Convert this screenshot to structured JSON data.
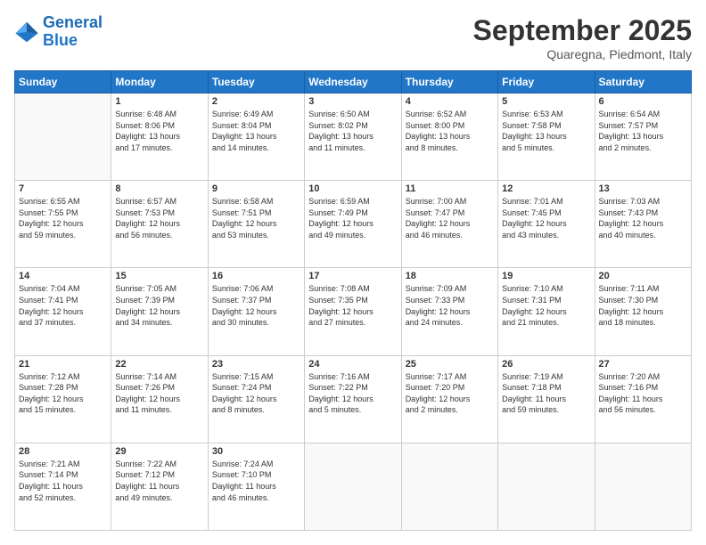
{
  "logo": {
    "line1": "General",
    "line2": "Blue"
  },
  "header": {
    "month": "September 2025",
    "location": "Quaregna, Piedmont, Italy"
  },
  "days_of_week": [
    "Sunday",
    "Monday",
    "Tuesday",
    "Wednesday",
    "Thursday",
    "Friday",
    "Saturday"
  ],
  "weeks": [
    [
      {
        "day": "",
        "info": ""
      },
      {
        "day": "1",
        "info": "Sunrise: 6:48 AM\nSunset: 8:06 PM\nDaylight: 13 hours\nand 17 minutes."
      },
      {
        "day": "2",
        "info": "Sunrise: 6:49 AM\nSunset: 8:04 PM\nDaylight: 13 hours\nand 14 minutes."
      },
      {
        "day": "3",
        "info": "Sunrise: 6:50 AM\nSunset: 8:02 PM\nDaylight: 13 hours\nand 11 minutes."
      },
      {
        "day": "4",
        "info": "Sunrise: 6:52 AM\nSunset: 8:00 PM\nDaylight: 13 hours\nand 8 minutes."
      },
      {
        "day": "5",
        "info": "Sunrise: 6:53 AM\nSunset: 7:58 PM\nDaylight: 13 hours\nand 5 minutes."
      },
      {
        "day": "6",
        "info": "Sunrise: 6:54 AM\nSunset: 7:57 PM\nDaylight: 13 hours\nand 2 minutes."
      }
    ],
    [
      {
        "day": "7",
        "info": "Sunrise: 6:55 AM\nSunset: 7:55 PM\nDaylight: 12 hours\nand 59 minutes."
      },
      {
        "day": "8",
        "info": "Sunrise: 6:57 AM\nSunset: 7:53 PM\nDaylight: 12 hours\nand 56 minutes."
      },
      {
        "day": "9",
        "info": "Sunrise: 6:58 AM\nSunset: 7:51 PM\nDaylight: 12 hours\nand 53 minutes."
      },
      {
        "day": "10",
        "info": "Sunrise: 6:59 AM\nSunset: 7:49 PM\nDaylight: 12 hours\nand 49 minutes."
      },
      {
        "day": "11",
        "info": "Sunrise: 7:00 AM\nSunset: 7:47 PM\nDaylight: 12 hours\nand 46 minutes."
      },
      {
        "day": "12",
        "info": "Sunrise: 7:01 AM\nSunset: 7:45 PM\nDaylight: 12 hours\nand 43 minutes."
      },
      {
        "day": "13",
        "info": "Sunrise: 7:03 AM\nSunset: 7:43 PM\nDaylight: 12 hours\nand 40 minutes."
      }
    ],
    [
      {
        "day": "14",
        "info": "Sunrise: 7:04 AM\nSunset: 7:41 PM\nDaylight: 12 hours\nand 37 minutes."
      },
      {
        "day": "15",
        "info": "Sunrise: 7:05 AM\nSunset: 7:39 PM\nDaylight: 12 hours\nand 34 minutes."
      },
      {
        "day": "16",
        "info": "Sunrise: 7:06 AM\nSunset: 7:37 PM\nDaylight: 12 hours\nand 30 minutes."
      },
      {
        "day": "17",
        "info": "Sunrise: 7:08 AM\nSunset: 7:35 PM\nDaylight: 12 hours\nand 27 minutes."
      },
      {
        "day": "18",
        "info": "Sunrise: 7:09 AM\nSunset: 7:33 PM\nDaylight: 12 hours\nand 24 minutes."
      },
      {
        "day": "19",
        "info": "Sunrise: 7:10 AM\nSunset: 7:31 PM\nDaylight: 12 hours\nand 21 minutes."
      },
      {
        "day": "20",
        "info": "Sunrise: 7:11 AM\nSunset: 7:30 PM\nDaylight: 12 hours\nand 18 minutes."
      }
    ],
    [
      {
        "day": "21",
        "info": "Sunrise: 7:12 AM\nSunset: 7:28 PM\nDaylight: 12 hours\nand 15 minutes."
      },
      {
        "day": "22",
        "info": "Sunrise: 7:14 AM\nSunset: 7:26 PM\nDaylight: 12 hours\nand 11 minutes."
      },
      {
        "day": "23",
        "info": "Sunrise: 7:15 AM\nSunset: 7:24 PM\nDaylight: 12 hours\nand 8 minutes."
      },
      {
        "day": "24",
        "info": "Sunrise: 7:16 AM\nSunset: 7:22 PM\nDaylight: 12 hours\nand 5 minutes."
      },
      {
        "day": "25",
        "info": "Sunrise: 7:17 AM\nSunset: 7:20 PM\nDaylight: 12 hours\nand 2 minutes."
      },
      {
        "day": "26",
        "info": "Sunrise: 7:19 AM\nSunset: 7:18 PM\nDaylight: 11 hours\nand 59 minutes."
      },
      {
        "day": "27",
        "info": "Sunrise: 7:20 AM\nSunset: 7:16 PM\nDaylight: 11 hours\nand 56 minutes."
      }
    ],
    [
      {
        "day": "28",
        "info": "Sunrise: 7:21 AM\nSunset: 7:14 PM\nDaylight: 11 hours\nand 52 minutes."
      },
      {
        "day": "29",
        "info": "Sunrise: 7:22 AM\nSunset: 7:12 PM\nDaylight: 11 hours\nand 49 minutes."
      },
      {
        "day": "30",
        "info": "Sunrise: 7:24 AM\nSunset: 7:10 PM\nDaylight: 11 hours\nand 46 minutes."
      },
      {
        "day": "",
        "info": ""
      },
      {
        "day": "",
        "info": ""
      },
      {
        "day": "",
        "info": ""
      },
      {
        "day": "",
        "info": ""
      }
    ]
  ]
}
